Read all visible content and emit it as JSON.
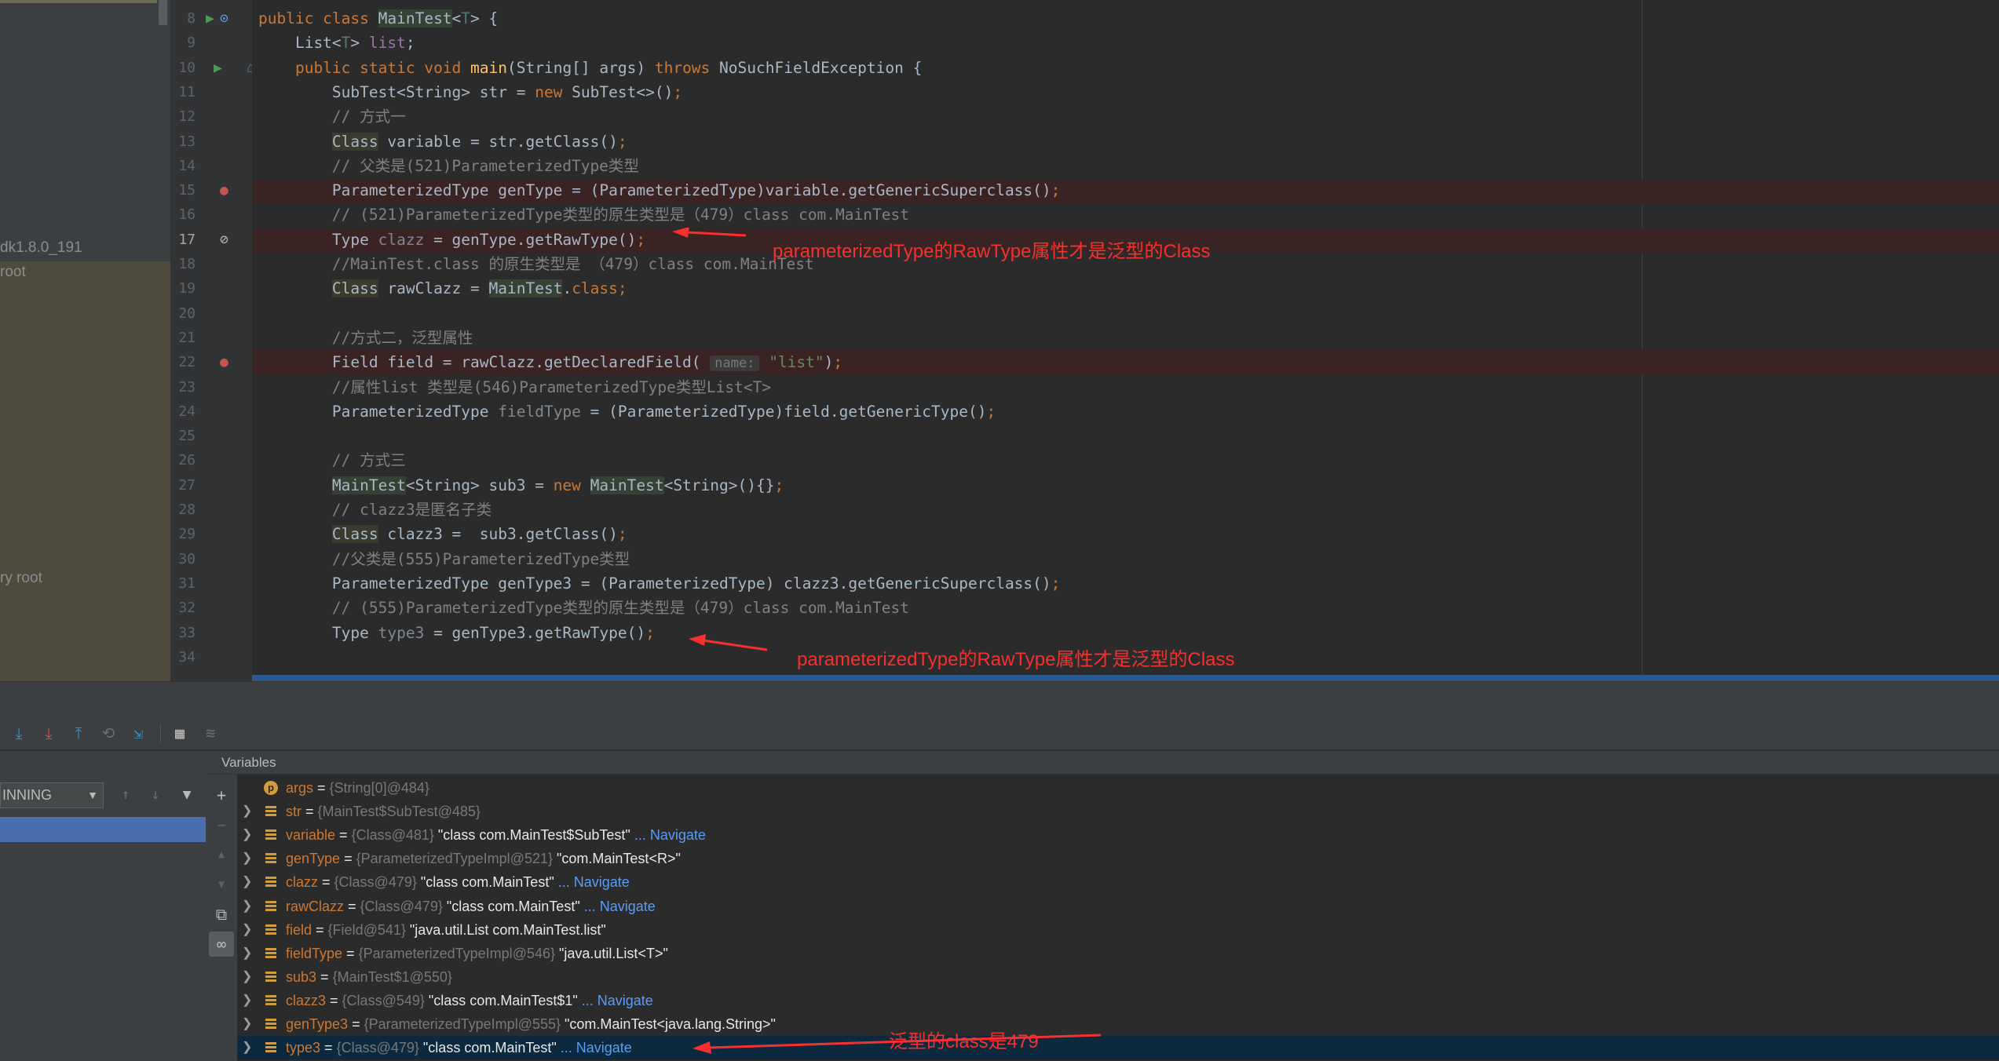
{
  "project": {
    "sdk_label": "dk1.8.0_191",
    "root_label": " root",
    "library_root_label": "ry root"
  },
  "editor": {
    "lines": [
      {
        "n": "8",
        "html": "<span class='kw'>public class </span><span class='hl'>MainTest</span>&lt;<span class='tp'>T</span>&gt; {"
      },
      {
        "n": "9",
        "html": "    List&lt;<span class='tp'>T</span>&gt; <span class='fld'>list</span>;"
      },
      {
        "n": "10",
        "html": "    <span class='kw'>public static void </span><span class='meth'>main</span>(String[] args) <span class='kw'>throws </span>NoSuchFieldException {"
      },
      {
        "n": "11",
        "html": "        SubTest&lt;String&gt; str = <span class='kw'>new </span>SubTest&lt;&gt;()<span class='kw'>;</span>"
      },
      {
        "n": "12",
        "html": "        <span class='cm'>// 方式一</span>"
      },
      {
        "n": "13",
        "html": "        <span class='hlc'>Class</span> variable = str.getClass()<span class='kw'>;</span>"
      },
      {
        "n": "14",
        "html": "        <span class='cm'>// 父类是(521)ParameterizedType类型</span>"
      },
      {
        "n": "15",
        "html": "        ParameterizedType genType = (ParameterizedType)variable.getGenericSuperclass()<span class='kw'>;</span>"
      },
      {
        "n": "16",
        "html": "        <span class='cm'>// (521)ParameterizedType类型的原生类型是（479）class com.MainTest</span>"
      },
      {
        "n": "17",
        "html": "        Type <span class='un'>clazz</span> = genType.getRawType()<span class='kw'>;</span>"
      },
      {
        "n": "18",
        "html": "        <span class='cm'>//MainTest.class 的原生类型是 （479）class com.MainTest</span>"
      },
      {
        "n": "19",
        "html": "        <span class='hlc'>Class</span> rawClazz = <span class='hl'>MainTest</span>.<span class='kw'>class;</span>"
      },
      {
        "n": "20",
        "html": ""
      },
      {
        "n": "21",
        "html": "        <span class='cm'>//方式二，泛型属性</span>"
      },
      {
        "n": "22",
        "html": "        Field field = rawClazz.getDeclaredField( <span class='hint'>name:</span> <span class='str'>\"list\"</span>)<span class='kw'>;</span>"
      },
      {
        "n": "23",
        "html": "        <span class='cm'>//属性list 类型是(546)ParameterizedType类型List&lt;T&gt;</span>"
      },
      {
        "n": "24",
        "html": "        ParameterizedType <span class='un'>fieldType</span> = (ParameterizedType)field.getGenericType()<span class='kw'>;</span>"
      },
      {
        "n": "25",
        "html": ""
      },
      {
        "n": "26",
        "html": "        <span class='cm'>// 方式三</span>"
      },
      {
        "n": "27",
        "html": "        <span class='hl'>MainTest</span>&lt;String&gt; sub3 = <span class='kw'>new </span><span class='hl'>MainTest</span>&lt;String&gt;(){}<span class='kw'>;</span>"
      },
      {
        "n": "28",
        "html": "        <span class='cm'>// clazz3是匿名子类</span>"
      },
      {
        "n": "29",
        "html": "        <span class='hlc'>Class</span> clazz3 =  sub3.getClass()<span class='kw'>;</span>"
      },
      {
        "n": "30",
        "html": "        <span class='cm'>//父类是(555)ParameterizedType类型</span>"
      },
      {
        "n": "31",
        "html": "        ParameterizedType genType3 = (ParameterizedType) clazz3.getGenericSuperclass()<span class='kw'>;</span>"
      },
      {
        "n": "32",
        "html": "        <span class='cm'>// (555)ParameterizedType类型的原生类型是（479）class com.MainTest</span>"
      },
      {
        "n": "33",
        "html": "        Type <span class='un'>type3</span> = genType3.getRawType()<span class='kw'>;</span>"
      },
      {
        "n": "34",
        "html": ""
      }
    ],
    "annotations": {
      "a1": "parameterizedType的RawType属性才是泛型的Class",
      "a2": "parameterizedType的RawType属性才是泛型的Class",
      "a3": "泛型的class是479"
    },
    "colors": {
      "annotation": "#f5302e",
      "breakpoint": "#c75450",
      "run": "#499c54"
    }
  },
  "debugger": {
    "variables_title": "Variables",
    "thread_select": "INNING",
    "variables": [
      {
        "name": "args",
        "type": "{String[0]@484}",
        "value": "",
        "nav": "",
        "icon": "param",
        "expand": false
      },
      {
        "name": "str",
        "type": "{MainTest$SubTest@485}",
        "value": "",
        "nav": "",
        "icon": "field",
        "expand": true
      },
      {
        "name": "variable",
        "type": "{Class@481}",
        "value": "\"class com.MainTest$SubTest\"",
        "nav": "... Navigate",
        "icon": "field",
        "expand": true
      },
      {
        "name": "genType",
        "type": "{ParameterizedTypeImpl@521}",
        "value": "\"com.MainTest<R>\"",
        "nav": "",
        "icon": "field",
        "expand": true
      },
      {
        "name": "clazz",
        "type": "{Class@479}",
        "value": "\"class com.MainTest\"",
        "nav": "... Navigate",
        "icon": "field",
        "expand": true
      },
      {
        "name": "rawClazz",
        "type": "{Class@479}",
        "value": "\"class com.MainTest\"",
        "nav": "... Navigate",
        "icon": "field",
        "expand": true
      },
      {
        "name": "field",
        "type": "{Field@541}",
        "value": "\"java.util.List com.MainTest.list\"",
        "nav": "",
        "icon": "field",
        "expand": true
      },
      {
        "name": "fieldType",
        "type": "{ParameterizedTypeImpl@546}",
        "value": "\"java.util.List<T>\"",
        "nav": "",
        "icon": "field",
        "expand": true
      },
      {
        "name": "sub3",
        "type": "{MainTest$1@550}",
        "value": "",
        "nav": "",
        "icon": "field",
        "expand": true
      },
      {
        "name": "clazz3",
        "type": "{Class@549}",
        "value": "\"class com.MainTest$1\"",
        "nav": "... Navigate",
        "icon": "field",
        "expand": true
      },
      {
        "name": "genType3",
        "type": "{ParameterizedTypeImpl@555}",
        "value": "\"com.MainTest<java.lang.String>\"",
        "nav": "",
        "icon": "field",
        "expand": true
      },
      {
        "name": "type3",
        "type": "{Class@479}",
        "value": "\"class com.MainTest\"",
        "nav": "... Navigate",
        "icon": "field",
        "expand": true
      }
    ]
  }
}
